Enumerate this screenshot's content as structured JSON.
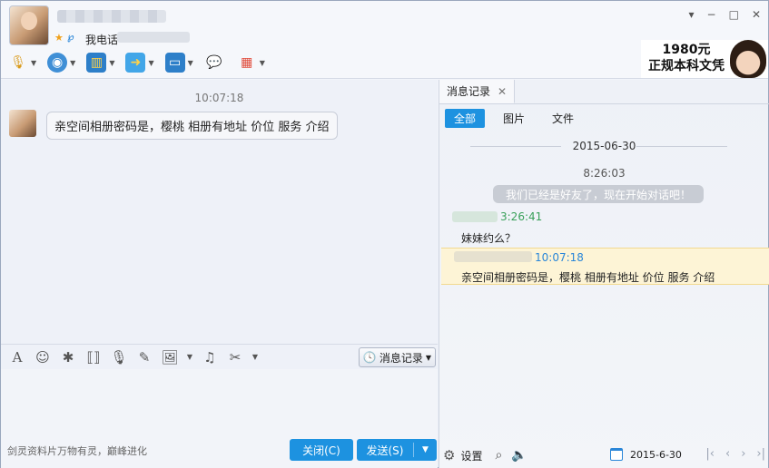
{
  "header": {
    "signature": "我电话",
    "window_controls": [
      "▾",
      "−",
      "□",
      "✕"
    ],
    "ad": {
      "line1": "1980元",
      "line2": "正规本科文凭"
    }
  },
  "toolbar": {
    "items": [
      "mic-icon",
      "camera-icon",
      "screen-share-icon",
      "send-file-icon",
      "remote-desktop-icon",
      "new-chat-icon",
      "apps-icon"
    ]
  },
  "chat": {
    "time": "10:07:18",
    "message": "亲空间相册密码是，樱桃   相册有地址 价位 服务 介绍"
  },
  "input": {
    "history_label": "消息记录",
    "slogan": "剑灵资料片万物有灵，巅峰进化",
    "close_label": "关闭(C)",
    "send_label": "发送(S)"
  },
  "history": {
    "tab_label": "消息记录",
    "filters": [
      "全部",
      "图片",
      "文件"
    ],
    "date": "2015-06-30",
    "time1": "8:26:03",
    "system_note": "我们已经是好友了，现在开始对话吧！",
    "sender_time": "3:26:41",
    "msg1": "妹妹约么？",
    "self_time": "10:07:18",
    "msg2": "亲空间相册密码是，樱桃   相册有地址 价位 服务 介绍",
    "settings_label": "设置",
    "footer_date": "2015-6-30"
  }
}
